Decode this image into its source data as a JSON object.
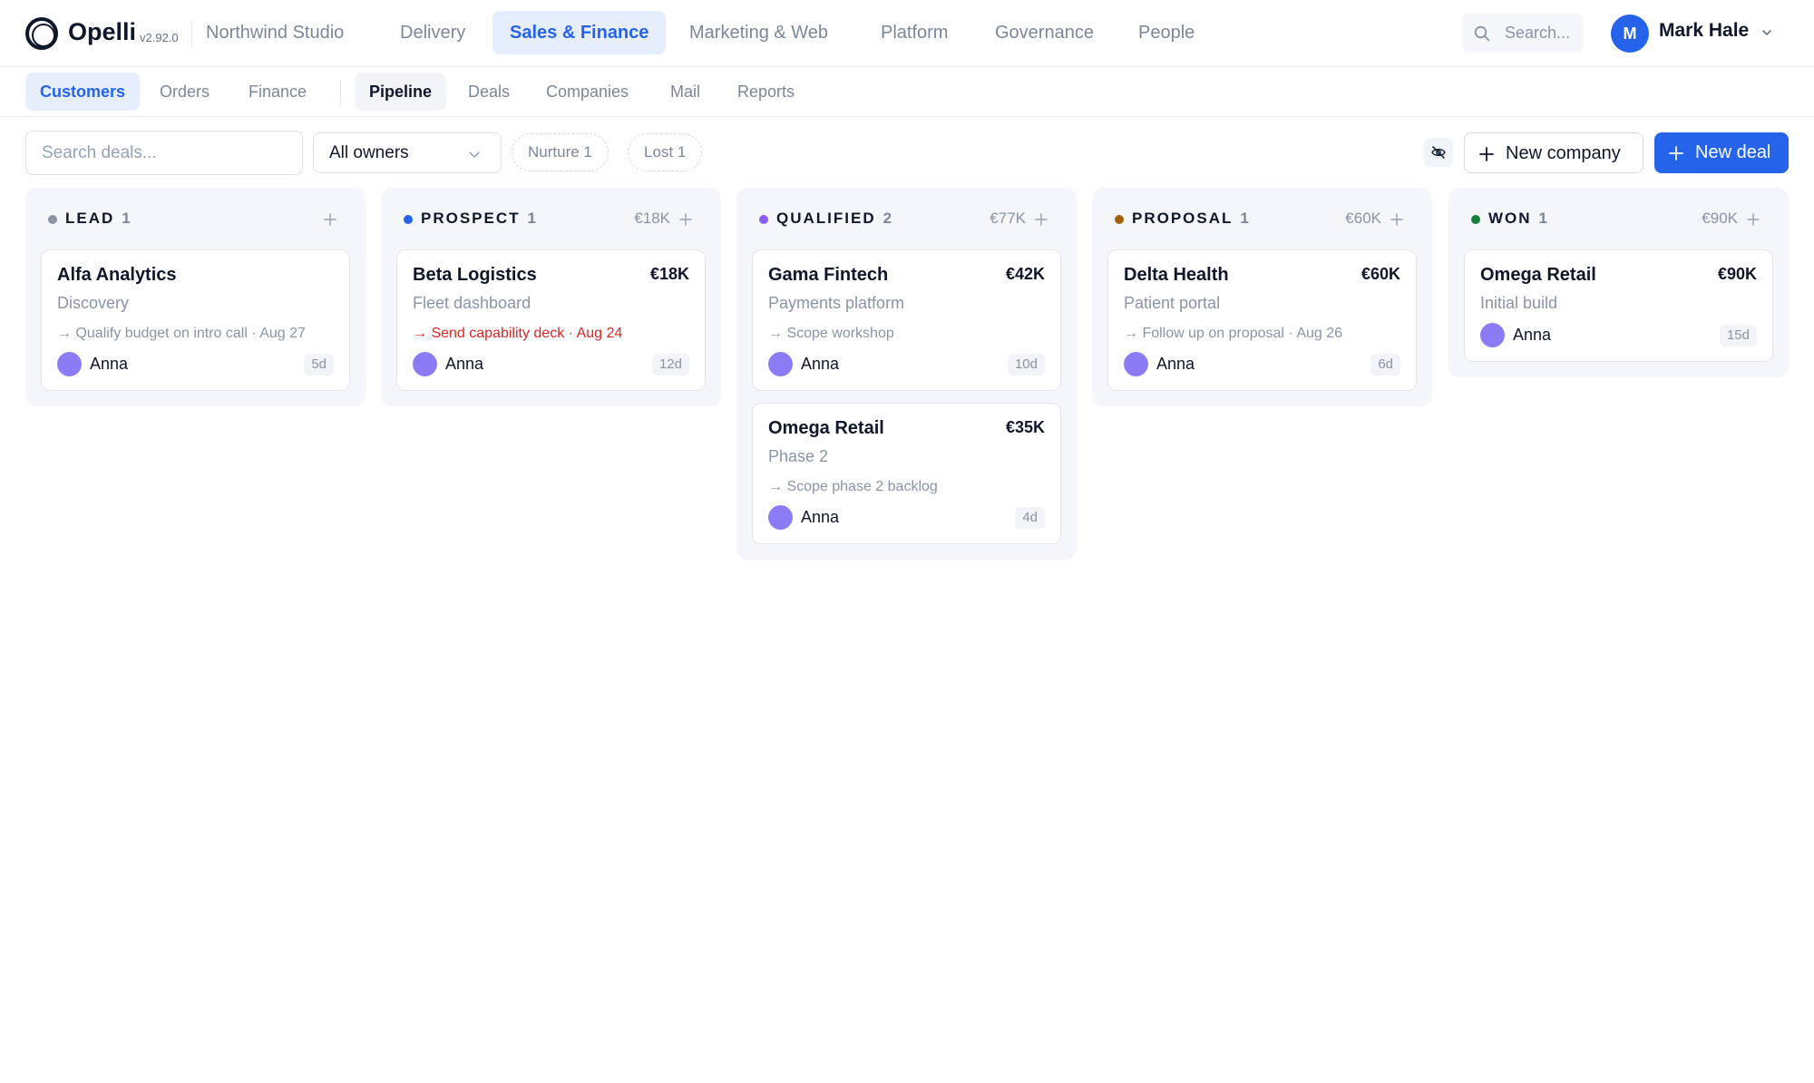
{
  "app": {
    "name": "Opelli",
    "version": "v2.92.0",
    "workspace": "Northwind Studio"
  },
  "topnav": [
    {
      "label": "Delivery",
      "active": false
    },
    {
      "label": "Sales & Finance",
      "active": true
    },
    {
      "label": "Marketing & Web",
      "active": false
    },
    {
      "label": "Platform",
      "active": false
    },
    {
      "label": "Governance",
      "active": false
    },
    {
      "label": "People",
      "active": false
    }
  ],
  "search": {
    "placeholder": "Search..."
  },
  "user": {
    "initial": "M",
    "name": "Mark Hale"
  },
  "subnav": {
    "group1": [
      {
        "label": "Customers",
        "active": true
      },
      {
        "label": "Orders",
        "active": false
      },
      {
        "label": "Finance",
        "active": false
      }
    ],
    "group2": [
      {
        "label": "Pipeline",
        "active": true
      },
      {
        "label": "Deals",
        "active": false
      },
      {
        "label": "Companies",
        "active": false
      },
      {
        "label": "Mail",
        "active": false
      },
      {
        "label": "Reports",
        "active": false
      }
    ]
  },
  "toolbar": {
    "search_placeholder": "Search deals...",
    "owner_filter": "All owners",
    "pills": [
      {
        "label": "Nurture 1"
      },
      {
        "label": "Lost 1"
      }
    ],
    "new_company_label": "New company",
    "new_deal_label": "New deal"
  },
  "colors": {
    "accent": "#2563eb",
    "overdue": "#dc2626"
  },
  "columns": [
    {
      "title": "LEAD",
      "count": "1",
      "total": "",
      "dot_color": "#8a94a6",
      "cards": [
        {
          "title": "Alfa Analytics",
          "amount": "",
          "subtitle": "Discovery",
          "task": "→ Qualify budget on intro call · Aug 27",
          "overdue": false,
          "owner": "Anna",
          "age": "5d"
        }
      ]
    },
    {
      "title": "PROSPECT",
      "count": "1",
      "total": "€18K",
      "dot_color": "#2563eb",
      "cards": [
        {
          "title": "Beta Logistics",
          "amount": "€18K",
          "subtitle": "Fleet dashboard",
          "task": "→ Send capability deck · Aug 24",
          "overdue": true,
          "owner": "Anna",
          "age": "12d"
        }
      ]
    },
    {
      "title": "QUALIFIED",
      "count": "2",
      "total": "€77K",
      "dot_color": "#8b5cf6",
      "cards": [
        {
          "title": "Gama Fintech",
          "amount": "€42K",
          "subtitle": "Payments platform",
          "task": "→ Scope workshop",
          "overdue": false,
          "owner": "Anna",
          "age": "10d"
        },
        {
          "title": "Omega Retail",
          "amount": "€35K",
          "subtitle": "Phase 2",
          "task": "→ Scope phase 2 backlog",
          "overdue": false,
          "owner": "Anna",
          "age": "4d"
        }
      ]
    },
    {
      "title": "PROPOSAL",
      "count": "1",
      "total": "€60K",
      "dot_color": "#a16207",
      "cards": [
        {
          "title": "Delta Health",
          "amount": "€60K",
          "subtitle": "Patient portal",
          "task": "→ Follow up on proposal · Aug 26",
          "overdue": false,
          "owner": "Anna",
          "age": "6d"
        }
      ]
    },
    {
      "title": "WON",
      "count": "1",
      "total": "€90K",
      "dot_color": "#15803d",
      "cards": [
        {
          "title": "Omega Retail",
          "amount": "€90K",
          "subtitle": "Initial build",
          "task": "",
          "overdue": false,
          "owner": "Anna",
          "age": "15d"
        }
      ]
    }
  ]
}
